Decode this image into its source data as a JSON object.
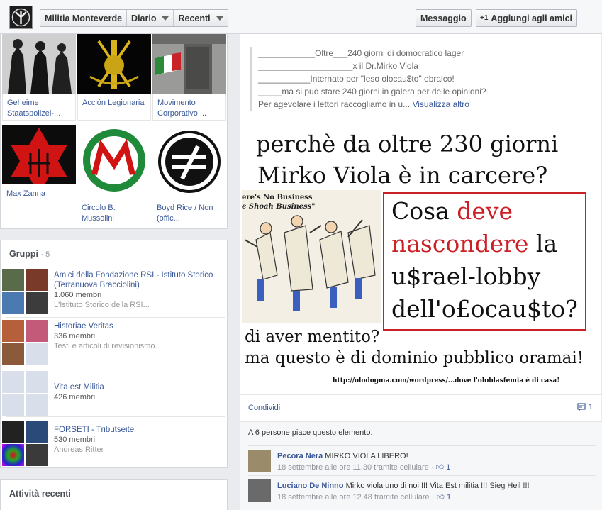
{
  "header": {
    "page_name": "Militia Monteverde",
    "tabs": [
      {
        "label": "Diario"
      },
      {
        "label": "Recenti"
      }
    ],
    "message_label": "Messaggio",
    "add_friend_label": "Aggiungi agli amici",
    "add_friend_symbol": "+1"
  },
  "photos": [
    {
      "caption": "Geheime Staatspolizei-..."
    },
    {
      "caption": "Acción Legionaria"
    },
    {
      "caption": "Movimento Corporativo ..."
    },
    {
      "caption": "Max Zanna"
    },
    {
      "caption": "Circolo B. Mussolini"
    },
    {
      "caption": "Boyd Rice / Non (offic..."
    }
  ],
  "groups": {
    "title": "Gruppi",
    "count": "· 5",
    "items": [
      {
        "name": "Amici della Fondazione RSI - Istituto Storico (Terranuova Bracciolini)",
        "members": "1.060 membri",
        "desc": "L'Istituto Storico della RSI..."
      },
      {
        "name": "Historiae Veritas",
        "members": "336 membri",
        "desc": "Testi e articoli di revisionismo..."
      },
      {
        "name": "Vita est Militia",
        "members": "426 membri",
        "desc": ""
      },
      {
        "name": "FORSETI - Tributseite",
        "members": "530 membri",
        "desc": "Andreas Ritter"
      }
    ]
  },
  "recent": {
    "title": "Attività recenti"
  },
  "post": {
    "lines": [
      "____________Oltre___240 giorni di domocratico lager",
      "____________________x il Dr.Mirko Viola",
      "___________Internato per \"leso olocau$to\" ebraico!",
      "_____ma si può stare 240 giorni in galera per delle opinioni?"
    ],
    "last_line": "Per agevolare i lettori raccogliamo in u...",
    "see_more": "Visualizza altro",
    "poster": {
      "line1": "perchè da oltre 230 giorni",
      "line2": "Mirko Viola è in carcere?",
      "cartoon_caption_1": "ere's No Business",
      "cartoon_caption_2": "e Shoah Business\"",
      "box_1a": "Cosa ",
      "box_1b": "deve",
      "box_2a": "nascondere",
      "box_2b": " la",
      "box_3": "u$rael-lobby",
      "box_4": "dell'o£ocau$to?",
      "line3": "di aver mentito?",
      "line4": "ma questo è di dominio pubblico oramai!",
      "url": "http://olodogma.com/wordpress/...dove l'oloblasfemia è di casa!"
    },
    "share_label": "Condividi",
    "comment_count": "1",
    "likes_text": "A 6 persone piace questo elemento.",
    "comments": [
      {
        "author": "Pecora Nera",
        "text": "MIRKO VIOLA LIBERO!",
        "time": "18 settembre alle ore 11.30 tramite cellulare",
        "likes": "1"
      },
      {
        "author": "Luciano De Ninno",
        "text": "Mirko viola uno di noi !!! Vita Est militia !!! Sieg Heil !!!",
        "time": "18 settembre alle ore 12.48 tramite cellulare",
        "likes": "1"
      }
    ]
  }
}
